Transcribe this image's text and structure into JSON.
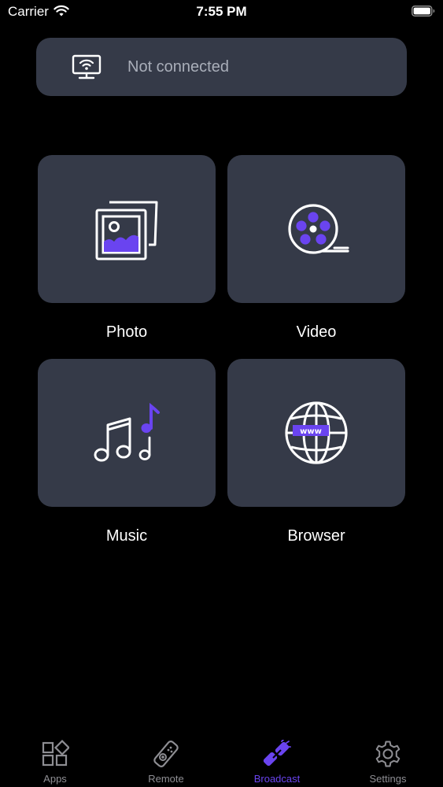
{
  "status_bar": {
    "carrier": "Carrier",
    "time": "7:55 PM"
  },
  "connection": {
    "status": "Not connected",
    "icon": "cast-tv-icon"
  },
  "tiles": [
    {
      "label": "Photo",
      "icon": "photo-icon"
    },
    {
      "label": "Video",
      "icon": "film-reel-icon"
    },
    {
      "label": "Music",
      "icon": "music-notes-icon"
    },
    {
      "label": "Browser",
      "icon": "globe-www-icon"
    }
  ],
  "tab_bar": {
    "tabs": [
      {
        "label": "Apps",
        "icon": "apps-grid-icon",
        "active": false
      },
      {
        "label": "Remote",
        "icon": "remote-icon",
        "active": false
      },
      {
        "label": "Broadcast",
        "icon": "broadcast-icon",
        "active": true
      },
      {
        "label": "Settings",
        "icon": "gear-icon",
        "active": false
      }
    ]
  },
  "colors": {
    "background": "#000000",
    "card": "#353a48",
    "accent": "#6a44f0",
    "muted_text": "#a9aeb9",
    "inactive_tab": "#8e8e93"
  }
}
